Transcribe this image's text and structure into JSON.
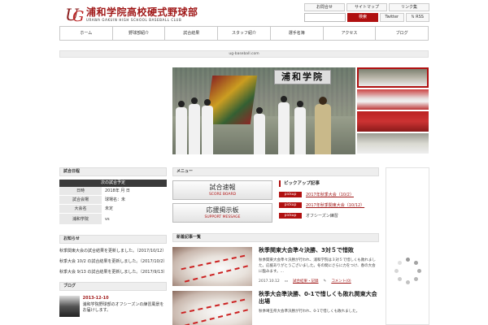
{
  "header": {
    "logo_mark": "UG",
    "logo_title": "浦和学院高校硬式野球部",
    "logo_subtitle": "URAWA GAKUIN HIGH SCHOOL BASEBALL CLUB",
    "top_links": [
      "お問合せ",
      "サイトマップ",
      "リンク集"
    ],
    "search_placeholder": "",
    "search_button": "検索",
    "social": [
      "Twitter",
      "RSS"
    ]
  },
  "nav": {
    "items": [
      "ホーム",
      "野球部紹介",
      "試合結果",
      "スタッフ紹介",
      "選手名簿",
      "アクセス",
      "ブログ"
    ]
  },
  "url_bar": "ug-baseball.com",
  "hero": {
    "sign": "浦和学院"
  },
  "schedule": {
    "head": "試合日程",
    "subhead": "次の試合予定",
    "rows": [
      {
        "k": "日時",
        "v": "2018年 月 日"
      },
      {
        "k": "試合会場",
        "v": "球場名：未"
      },
      {
        "k": "大会名",
        "v": "未定"
      },
      {
        "k": "浦和学院",
        "v": "vs"
      }
    ]
  },
  "news": {
    "head": "お知らせ",
    "items": [
      "秋季関東大会の試合結果を更新しました。（2017/10/12）",
      "秋季大会 10/2 の試合結果を更新しました。（2017/10/2）",
      "秋季大会 9/13 の試合結果を更新しました。（2017/9/13）"
    ]
  },
  "blog": {
    "head": "ブログ",
    "date": "2013-12-10",
    "title": "浦和学院野球部のオフシーズンの練習風景をお届けします。"
  },
  "menu": {
    "head": "メニュー",
    "buttons": [
      {
        "jp": "試合速報",
        "en": "SCORE BOARD"
      },
      {
        "jp": "応援掲示板",
        "en": "SUPPORT MESSAGE"
      }
    ]
  },
  "pickup": {
    "title": "ピックアップ記事",
    "badge": "pickup",
    "items": [
      "2017年秋季大会（10/2）",
      "2017年秋季関東大会（10/12）",
      "オフシーズン練習"
    ]
  },
  "latest": {
    "head": "新着記事一覧",
    "articles": [
      {
        "title": "秋季関東大会準々決勝、3対５で惜敗",
        "text": "秋季関東大会準々決勝が行われ、浦和学院は３対５で惜しくも敗れました。応援ありがとうございました。冬の間にさらに力をつけ、春の大会に臨みます。…",
        "date": "2017.10.12",
        "category": "試合結果・記録",
        "comments": "コメント(0)"
      },
      {
        "title": "秋季大会準決勝、0-1で惜しくも敗れ関東大会出場",
        "text": "秋季埼玉県大会準決勝が行われ、0-1で惜しくも敗れました。",
        "date": "",
        "category": "",
        "comments": ""
      }
    ]
  },
  "colors": {
    "accent": "#b01010",
    "logo": "#a01818"
  }
}
